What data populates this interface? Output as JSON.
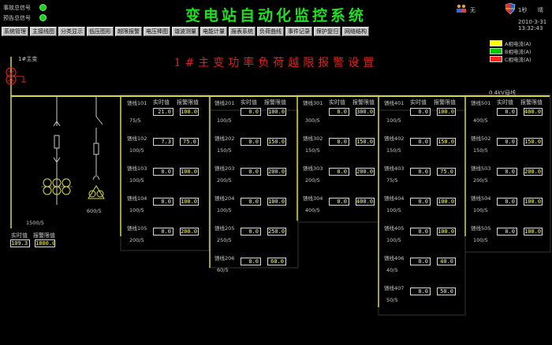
{
  "header": {
    "signal_accident": "事故总信号",
    "signal_warning": "预告总信号",
    "title": "变电站自动化监控系统",
    "user": "无",
    "date": "2010-3-31",
    "time": "13:32:43",
    "weather": "晴"
  },
  "nav": [
    "系统管理",
    "主接线图",
    "分类显示",
    "低压图形",
    "越限报警",
    "电压棒图",
    "谐波测量",
    "电能计量",
    "报表系统",
    "负荷曲线",
    "事件记录",
    "保护复归",
    "网络结构"
  ],
  "alarm_title": "1#主变功率负荷越限报警设置",
  "legend": [
    {
      "label": "A相电流(A)",
      "color": "#ffff00"
    },
    {
      "label": "B相电流(A)",
      "color": "#00cc00"
    },
    {
      "label": "C相电流(A)",
      "color": "#ff2020"
    }
  ],
  "busbar_label": "0.4kV母线",
  "transformer": {
    "label": "1#主变",
    "ratio": "1500/5",
    "hdr_actual": "实时值",
    "hdr_limit": "报警限值",
    "actual": "109.3",
    "limit": "1800.0"
  },
  "branch_ratio": "600/5",
  "col_headers": {
    "actual": "实时值",
    "limit": "报警限值"
  },
  "feeders": [
    [
      {
        "name": "馈线101",
        "ratio": "75/5",
        "actual": "21.0",
        "limit": "100.0"
      },
      {
        "name": "馈线102",
        "ratio": "100/5",
        "actual": "7.3",
        "limit": "75.0"
      },
      {
        "name": "馈线103",
        "ratio": "100/5",
        "actual": "0.0",
        "limit": "100.0"
      },
      {
        "name": "馈线104",
        "ratio": "100/5",
        "actual": "0.0",
        "limit": "100.0"
      },
      {
        "name": "馈线105",
        "ratio": "200/5",
        "actual": "0.0",
        "limit": "200.0"
      }
    ],
    [
      {
        "name": "馈线201",
        "ratio": "100/5",
        "actual": "0.0",
        "limit": "100.0"
      },
      {
        "name": "馈线202",
        "ratio": "150/5",
        "actual": "0.0",
        "limit": "150.0"
      },
      {
        "name": "馈线203",
        "ratio": "200/5",
        "actual": "0.0",
        "limit": "200.0"
      },
      {
        "name": "馈线204",
        "ratio": "100/5",
        "actual": "0.0",
        "limit": "100.0"
      },
      {
        "name": "馈线205",
        "ratio": "250/5",
        "actual": "0.0",
        "limit": "250.0"
      },
      {
        "name": "馈线206",
        "ratio": "60/5",
        "actual": "0.0",
        "limit": "60.0"
      }
    ],
    [
      {
        "name": "馈线301",
        "ratio": "300/5",
        "actual": "0.0",
        "limit": "300.0"
      },
      {
        "name": "馈线302",
        "ratio": "150/5",
        "actual": "0.0",
        "limit": "150.0"
      },
      {
        "name": "馈线303",
        "ratio": "200/5",
        "actual": "0.0",
        "limit": "200.0"
      },
      {
        "name": "馈线304",
        "ratio": "400/5",
        "actual": "0.0",
        "limit": "400.0"
      }
    ],
    [
      {
        "name": "馈线401",
        "ratio": "100/5",
        "actual": "0.0",
        "limit": "100.0"
      },
      {
        "name": "馈线402",
        "ratio": "150/5",
        "actual": "0.0",
        "limit": "150.0"
      },
      {
        "name": "馈线403",
        "ratio": "75/5",
        "actual": "0.0",
        "limit": "75.0"
      },
      {
        "name": "馈线404",
        "ratio": "100/5",
        "actual": "0.0",
        "limit": "100.0"
      },
      {
        "name": "馈线405",
        "ratio": "100/5",
        "actual": "0.0",
        "limit": "100.0"
      },
      {
        "name": "馈线406",
        "ratio": "40/5",
        "actual": "0.0",
        "limit": "40.0"
      },
      {
        "name": "馈线407",
        "ratio": "50/5",
        "actual": "0.0",
        "limit": "50.0"
      }
    ],
    [
      {
        "name": "馈线501",
        "ratio": "400/5",
        "actual": "0.0",
        "limit": "400.0"
      },
      {
        "name": "馈线502",
        "ratio": "150/5",
        "actual": "0.0",
        "limit": "150.0"
      },
      {
        "name": "馈线503",
        "ratio": "200/5",
        "actual": "0.0",
        "limit": "200.0"
      },
      {
        "name": "馈线504",
        "ratio": "100/5",
        "actual": "0.0",
        "limit": "100.0"
      },
      {
        "name": "馈线505",
        "ratio": "100/5",
        "actual": "0.0",
        "limit": "100.0"
      }
    ]
  ]
}
